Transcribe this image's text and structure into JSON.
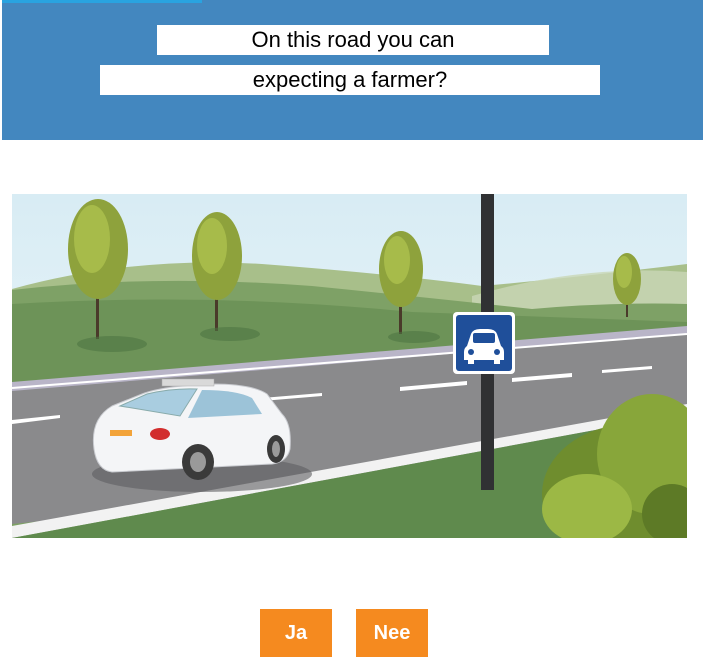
{
  "question": {
    "line1": "On this road you can",
    "line2": "expecting a farmer?"
  },
  "answers": {
    "yes_label": "Ja",
    "no_label": "Nee"
  },
  "colors": {
    "header_bg": "#4387bf",
    "button_bg": "#f58a1f",
    "sign_blue": "#1f4f9a"
  },
  "scene": {
    "sign_icon": "car-road-sign-icon",
    "vehicle": "white-car-icon"
  }
}
